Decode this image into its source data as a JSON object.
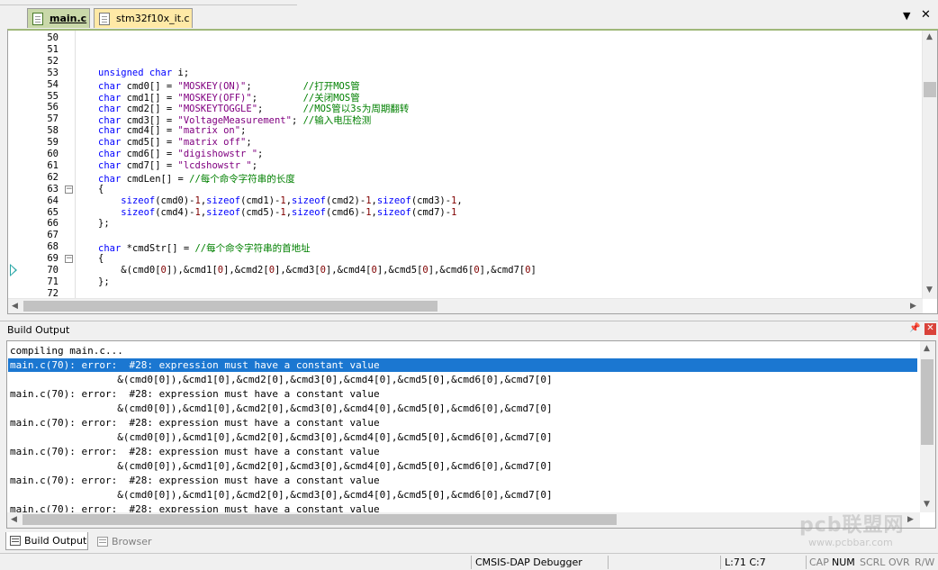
{
  "tabs": [
    {
      "label": "main.c",
      "active": true
    },
    {
      "label": "stm32f10x_it.c",
      "active": false
    }
  ],
  "editor": {
    "lines": [
      {
        "n": "50",
        "code": [],
        "fold": ""
      },
      {
        "n": "51",
        "code": [],
        "fold": ""
      },
      {
        "n": "52",
        "code": [],
        "fold": ""
      },
      {
        "n": "53",
        "code": [
          {
            "t": "unsigned char",
            "c": "kw"
          },
          {
            "t": " i;",
            "c": ""
          }
        ],
        "fold": ""
      },
      {
        "n": "54",
        "code": [
          {
            "t": "char",
            "c": "kw"
          },
          {
            "t": " cmd0[] = ",
            "c": ""
          },
          {
            "t": "\"MOSKEY(ON)\"",
            "c": "str"
          },
          {
            "t": ";         ",
            "c": ""
          },
          {
            "t": "//打开MOS管",
            "c": "cm"
          }
        ],
        "fold": ""
      },
      {
        "n": "55",
        "code": [
          {
            "t": "char",
            "c": "kw"
          },
          {
            "t": " cmd1[] = ",
            "c": ""
          },
          {
            "t": "\"MOSKEY(OFF)\"",
            "c": "str"
          },
          {
            "t": ";        ",
            "c": ""
          },
          {
            "t": "//关闭MOS管",
            "c": "cm"
          }
        ],
        "fold": ""
      },
      {
        "n": "56",
        "code": [
          {
            "t": "char",
            "c": "kw"
          },
          {
            "t": " cmd2[] = ",
            "c": ""
          },
          {
            "t": "\"MOSKEYTOGGLE\"",
            "c": "str"
          },
          {
            "t": ";       ",
            "c": ""
          },
          {
            "t": "//MOS管以3s为周期翻转",
            "c": "cm"
          }
        ],
        "fold": ""
      },
      {
        "n": "57",
        "code": [
          {
            "t": "char",
            "c": "kw"
          },
          {
            "t": " cmd3[] = ",
            "c": ""
          },
          {
            "t": "\"VoltageMeasurement\"",
            "c": "str"
          },
          {
            "t": "; ",
            "c": ""
          },
          {
            "t": "//输入电压检测",
            "c": "cm"
          }
        ],
        "fold": ""
      },
      {
        "n": "58",
        "code": [
          {
            "t": "char",
            "c": "kw"
          },
          {
            "t": " cmd4[] = ",
            "c": ""
          },
          {
            "t": "\"matrix on\"",
            "c": "str"
          },
          {
            "t": ";",
            "c": ""
          }
        ],
        "fold": ""
      },
      {
        "n": "59",
        "code": [
          {
            "t": "char",
            "c": "kw"
          },
          {
            "t": " cmd5[] = ",
            "c": ""
          },
          {
            "t": "\"matrix off\"",
            "c": "str"
          },
          {
            "t": ";",
            "c": ""
          }
        ],
        "fold": ""
      },
      {
        "n": "60",
        "code": [
          {
            "t": "char",
            "c": "kw"
          },
          {
            "t": " cmd6[] = ",
            "c": ""
          },
          {
            "t": "\"digishowstr \"",
            "c": "str"
          },
          {
            "t": ";",
            "c": ""
          }
        ],
        "fold": ""
      },
      {
        "n": "61",
        "code": [
          {
            "t": "char",
            "c": "kw"
          },
          {
            "t": " cmd7[] = ",
            "c": ""
          },
          {
            "t": "\"lcdshowstr \"",
            "c": "str"
          },
          {
            "t": ";",
            "c": ""
          }
        ],
        "fold": ""
      },
      {
        "n": "62",
        "code": [
          {
            "t": "char",
            "c": "kw"
          },
          {
            "t": " cmdLen[] = ",
            "c": ""
          },
          {
            "t": "//每个命令字符串的长度",
            "c": "cm"
          }
        ],
        "fold": ""
      },
      {
        "n": "63",
        "code": [
          {
            "t": "{",
            "c": ""
          }
        ],
        "fold": "−"
      },
      {
        "n": "64",
        "code": [
          {
            "t": "    ",
            "c": ""
          },
          {
            "t": "sizeof",
            "c": "kw"
          },
          {
            "t": "(cmd0)-",
            "c": ""
          },
          {
            "t": "1",
            "c": "num"
          },
          {
            "t": ",",
            "c": ""
          },
          {
            "t": "sizeof",
            "c": "kw"
          },
          {
            "t": "(cmd1)-",
            "c": ""
          },
          {
            "t": "1",
            "c": "num"
          },
          {
            "t": ",",
            "c": ""
          },
          {
            "t": "sizeof",
            "c": "kw"
          },
          {
            "t": "(cmd2)-",
            "c": ""
          },
          {
            "t": "1",
            "c": "num"
          },
          {
            "t": ",",
            "c": ""
          },
          {
            "t": "sizeof",
            "c": "kw"
          },
          {
            "t": "(cmd3)-",
            "c": ""
          },
          {
            "t": "1",
            "c": "num"
          },
          {
            "t": ",",
            "c": ""
          }
        ],
        "fold": ""
      },
      {
        "n": "65",
        "code": [
          {
            "t": "    ",
            "c": ""
          },
          {
            "t": "sizeof",
            "c": "kw"
          },
          {
            "t": "(cmd4)-",
            "c": ""
          },
          {
            "t": "1",
            "c": "num"
          },
          {
            "t": ",",
            "c": ""
          },
          {
            "t": "sizeof",
            "c": "kw"
          },
          {
            "t": "(cmd5)-",
            "c": ""
          },
          {
            "t": "1",
            "c": "num"
          },
          {
            "t": ",",
            "c": ""
          },
          {
            "t": "sizeof",
            "c": "kw"
          },
          {
            "t": "(cmd6)-",
            "c": ""
          },
          {
            "t": "1",
            "c": "num"
          },
          {
            "t": ",",
            "c": ""
          },
          {
            "t": "sizeof",
            "c": "kw"
          },
          {
            "t": "(cmd7)-",
            "c": ""
          },
          {
            "t": "1",
            "c": "num"
          }
        ],
        "fold": ""
      },
      {
        "n": "66",
        "code": [
          {
            "t": "};",
            "c": ""
          }
        ],
        "fold": ""
      },
      {
        "n": "67",
        "code": [],
        "fold": ""
      },
      {
        "n": "68",
        "code": [
          {
            "t": "char",
            "c": "kw"
          },
          {
            "t": " *cmdStr[] = ",
            "c": ""
          },
          {
            "t": "//每个命令字符串的首地址",
            "c": "cm"
          }
        ],
        "fold": ""
      },
      {
        "n": "69",
        "code": [
          {
            "t": "{",
            "c": ""
          }
        ],
        "fold": "−"
      },
      {
        "n": "70",
        "code": [
          {
            "t": "    &(cmd0[",
            "c": ""
          },
          {
            "t": "0",
            "c": "num"
          },
          {
            "t": "]),&cmd1[",
            "c": ""
          },
          {
            "t": "0",
            "c": "num"
          },
          {
            "t": "],&cmd2[",
            "c": ""
          },
          {
            "t": "0",
            "c": "num"
          },
          {
            "t": "],&cmd3[",
            "c": ""
          },
          {
            "t": "0",
            "c": "num"
          },
          {
            "t": "],&cmd4[",
            "c": ""
          },
          {
            "t": "0",
            "c": "num"
          },
          {
            "t": "],&cmd5[",
            "c": ""
          },
          {
            "t": "0",
            "c": "num"
          },
          {
            "t": "],&cmd6[",
            "c": ""
          },
          {
            "t": "0",
            "c": "num"
          },
          {
            "t": "],&cmd7[",
            "c": ""
          },
          {
            "t": "0",
            "c": "num"
          },
          {
            "t": "]",
            "c": ""
          }
        ],
        "fold": ""
      },
      {
        "n": "71",
        "code": [
          {
            "t": "};",
            "c": ""
          }
        ],
        "fold": ""
      },
      {
        "n": "72",
        "code": [],
        "fold": ""
      }
    ]
  },
  "build_output": {
    "title": "Build Output",
    "lines": [
      {
        "text": "compiling main.c...",
        "selected": false
      },
      {
        "text": "main.c(70): error:  #28: expression must have a constant value",
        "selected": true
      },
      {
        "text": "                  &(cmd0[0]),&cmd1[0],&cmd2[0],&cmd3[0],&cmd4[0],&cmd5[0],&cmd6[0],&cmd7[0]",
        "selected": false
      },
      {
        "text": "main.c(70): error:  #28: expression must have a constant value",
        "selected": false
      },
      {
        "text": "                  &(cmd0[0]),&cmd1[0],&cmd2[0],&cmd3[0],&cmd4[0],&cmd5[0],&cmd6[0],&cmd7[0]",
        "selected": false
      },
      {
        "text": "main.c(70): error:  #28: expression must have a constant value",
        "selected": false
      },
      {
        "text": "                  &(cmd0[0]),&cmd1[0],&cmd2[0],&cmd3[0],&cmd4[0],&cmd5[0],&cmd6[0],&cmd7[0]",
        "selected": false
      },
      {
        "text": "main.c(70): error:  #28: expression must have a constant value",
        "selected": false
      },
      {
        "text": "                  &(cmd0[0]),&cmd1[0],&cmd2[0],&cmd3[0],&cmd4[0],&cmd5[0],&cmd6[0],&cmd7[0]",
        "selected": false
      },
      {
        "text": "main.c(70): error:  #28: expression must have a constant value",
        "selected": false
      },
      {
        "text": "                  &(cmd0[0]),&cmd1[0],&cmd2[0],&cmd3[0],&cmd4[0],&cmd5[0],&cmd6[0],&cmd7[0]",
        "selected": false
      },
      {
        "text": "main.c(70): error:  #28: expression must have a constant value",
        "selected": false
      }
    ]
  },
  "bottom_tabs": [
    {
      "label": "Build Output",
      "active": true
    },
    {
      "label": "Browser",
      "active": false
    }
  ],
  "statusbar": {
    "debugger": "CMSIS-DAP Debugger",
    "position": "L:71 C:7",
    "cap": "CAP",
    "num": "NUM",
    "scrl": "SCRL",
    "ovr": "OVR",
    "rw": "R/W"
  },
  "watermark": {
    "logo": "pcb联盟网",
    "url": "www.pcbbar.com"
  },
  "colors": {
    "keyword": "#0000ff",
    "string": "#800080",
    "comment": "#008000",
    "number": "#800000",
    "selection": "#1b77d1",
    "active_tab": "#c9d8a9",
    "inactive_tab": "#ffe9a6"
  },
  "icons": {
    "tab_file": "file-icon",
    "close": "close-icon",
    "dropdown": "chevron-down-icon",
    "pin": "pin-icon",
    "marker": "current-line-marker-icon"
  }
}
